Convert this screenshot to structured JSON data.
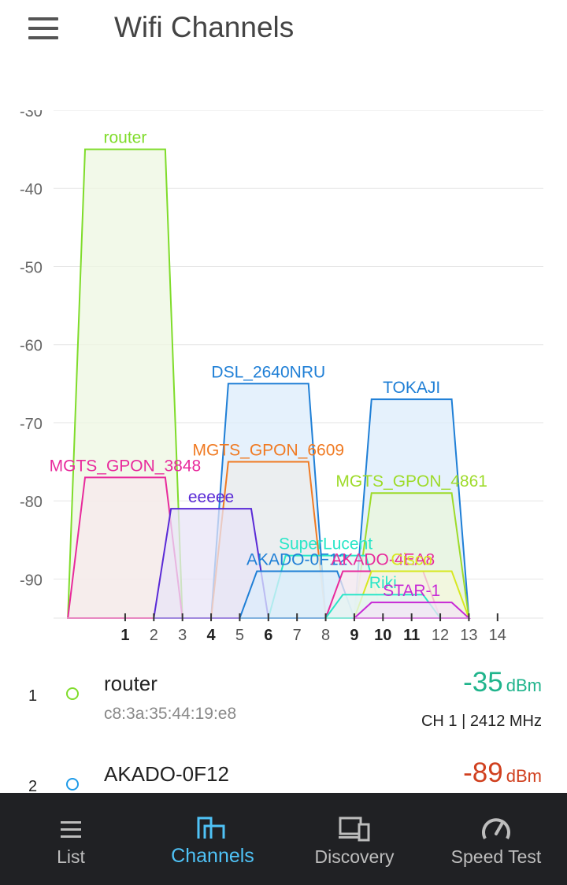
{
  "app": {
    "title": "Wifi Channels"
  },
  "chart_data": {
    "type": "area",
    "xlabel": "",
    "ylabel": "",
    "xlim": [
      -1.5,
      15.6
    ],
    "ylim": [
      -95,
      -30
    ],
    "yticks": [
      -30,
      -40,
      -50,
      -60,
      -70,
      -80,
      -90
    ],
    "xticks": [
      {
        "ch": 1,
        "bold": true
      },
      {
        "ch": 2,
        "bold": false
      },
      {
        "ch": 3,
        "bold": false
      },
      {
        "ch": 4,
        "bold": true
      },
      {
        "ch": 5,
        "bold": false
      },
      {
        "ch": 6,
        "bold": true
      },
      {
        "ch": 7,
        "bold": false
      },
      {
        "ch": 8,
        "bold": false
      },
      {
        "ch": 9,
        "bold": true
      },
      {
        "ch": 10,
        "bold": true
      },
      {
        "ch": 11,
        "bold": true
      },
      {
        "ch": 12,
        "bold": false
      },
      {
        "ch": 13,
        "bold": false
      },
      {
        "ch": 14,
        "bold": false
      }
    ],
    "grid": true,
    "series": [
      {
        "name": "router",
        "channel": 1,
        "dbm": -35,
        "color": "#7fdc2a",
        "fill": "#eef7e2"
      },
      {
        "name": "DSL_2640NRU",
        "channel": 6,
        "dbm": -65,
        "color": "#1f7fd6",
        "fill": "#dcecfb"
      },
      {
        "name": "TOKAJI",
        "channel": 11,
        "dbm": -67,
        "color": "#1f7fd6",
        "fill": "#dcecfb"
      },
      {
        "name": "MGTS_GPON_6609",
        "channel": 6,
        "dbm": -75,
        "color": "#f07a22",
        "fill": "#ececec"
      },
      {
        "name": "MGTS_GPON_3848",
        "channel": 1,
        "dbm": -77,
        "color": "#e82a9c",
        "fill": "#f7e8ec"
      },
      {
        "name": "MGTS_GPON_4861",
        "channel": 11,
        "dbm": -79,
        "color": "#9edb2a",
        "fill": "#eaf5dc"
      },
      {
        "name": "eeeee",
        "channel": 4,
        "dbm": -81,
        "color": "#5a2ad6",
        "fill": "#e8e4f7"
      },
      {
        "name": "SuperLucent",
        "channel": 8,
        "dbm": -87,
        "color": "#2ae6c8",
        "fill": "#e2f6f3"
      },
      {
        "name": "AKADO-0F12",
        "channel": 7,
        "dbm": -89,
        "color": "#1f7fd6",
        "fill": "#dcecfb"
      },
      {
        "name": "AKADO-4EA8",
        "channel": 10,
        "dbm": -89,
        "color": "#e82a9c",
        "fill": "#f8e8f0"
      },
      {
        "name": "Cisco",
        "channel": 11,
        "dbm": -89,
        "color": "#d8e820",
        "fill": "#f4f7de"
      },
      {
        "name": "Riki",
        "channel": 10,
        "dbm": -92,
        "color": "#2ae6c8",
        "fill": "#e2f6f3"
      },
      {
        "name": "STAR-1",
        "channel": 11,
        "dbm": -93,
        "color": "#c82ad6",
        "fill": "#f3e4f6"
      }
    ]
  },
  "list": [
    {
      "index": "1",
      "ssid": "router",
      "mac": "c8:3a:35:44:19:e8",
      "dbm": "-35",
      "unit": "dBm",
      "color": "#20b48c",
      "ch_info": "CH 1 | 2412 MHz"
    },
    {
      "index": "2",
      "ssid": "AKADO-0F12",
      "mac": "",
      "dbm": "-89",
      "unit": "dBm",
      "color": "#d0401f",
      "ch_info": ""
    }
  ],
  "nav": [
    {
      "label": "List",
      "icon": "list-icon"
    },
    {
      "label": "Channels",
      "icon": "channels-icon"
    },
    {
      "label": "Discovery",
      "icon": "discovery-icon"
    },
    {
      "label": "Speed Test",
      "icon": "speedometer-icon"
    }
  ]
}
